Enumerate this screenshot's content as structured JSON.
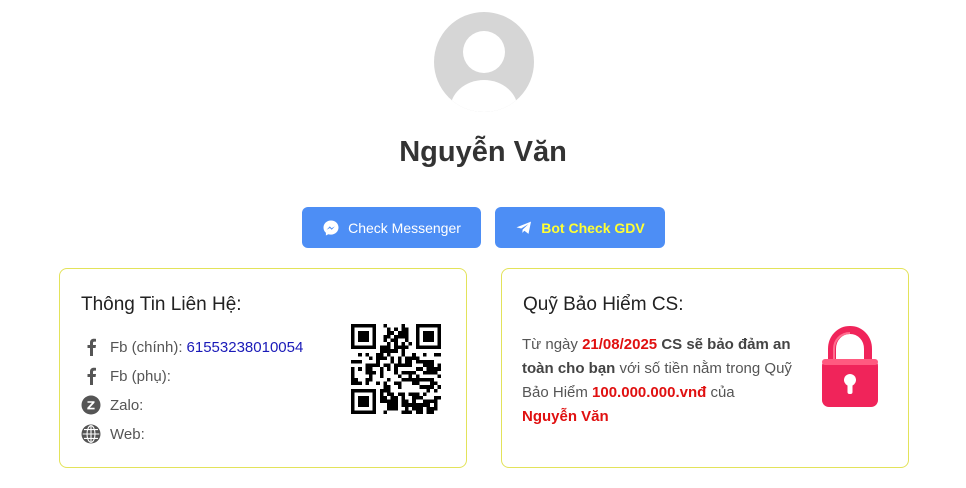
{
  "profile": {
    "name": "Nguyễn Văn"
  },
  "buttons": {
    "messenger": {
      "label": "Check Messenger",
      "icon": "messenger-icon"
    },
    "bot": {
      "label": "Bot Check GDV",
      "icon": "telegram-icon"
    }
  },
  "contact": {
    "title": "Thông Tin Liên Hệ:",
    "rows": [
      {
        "icon": "facebook-icon",
        "label": "Fb (chính):",
        "value": "61553238010054"
      },
      {
        "icon": "facebook-icon",
        "label": "Fb (phụ):",
        "value": ""
      },
      {
        "icon": "zalo-icon",
        "label": "Zalo:",
        "value": ""
      },
      {
        "icon": "globe-icon",
        "label": "Web:",
        "value": ""
      }
    ]
  },
  "insurance": {
    "title": "Quỹ Bảo Hiểm CS:",
    "p1": "Từ ngày ",
    "date": "21/08/2025",
    "p2": " CS sẽ bảo đảm an toàn cho bạn",
    "p3": " với số tiền nằm trong Quỹ Bảo Hiểm ",
    "amount": "100.000.000.vnđ",
    "p4": " của ",
    "owner": "Nguyễn Văn"
  },
  "colors": {
    "button": "#4d8ef5",
    "card_border": "#e3e35a",
    "accent_red": "#e01010",
    "lock": "#f0245a"
  }
}
